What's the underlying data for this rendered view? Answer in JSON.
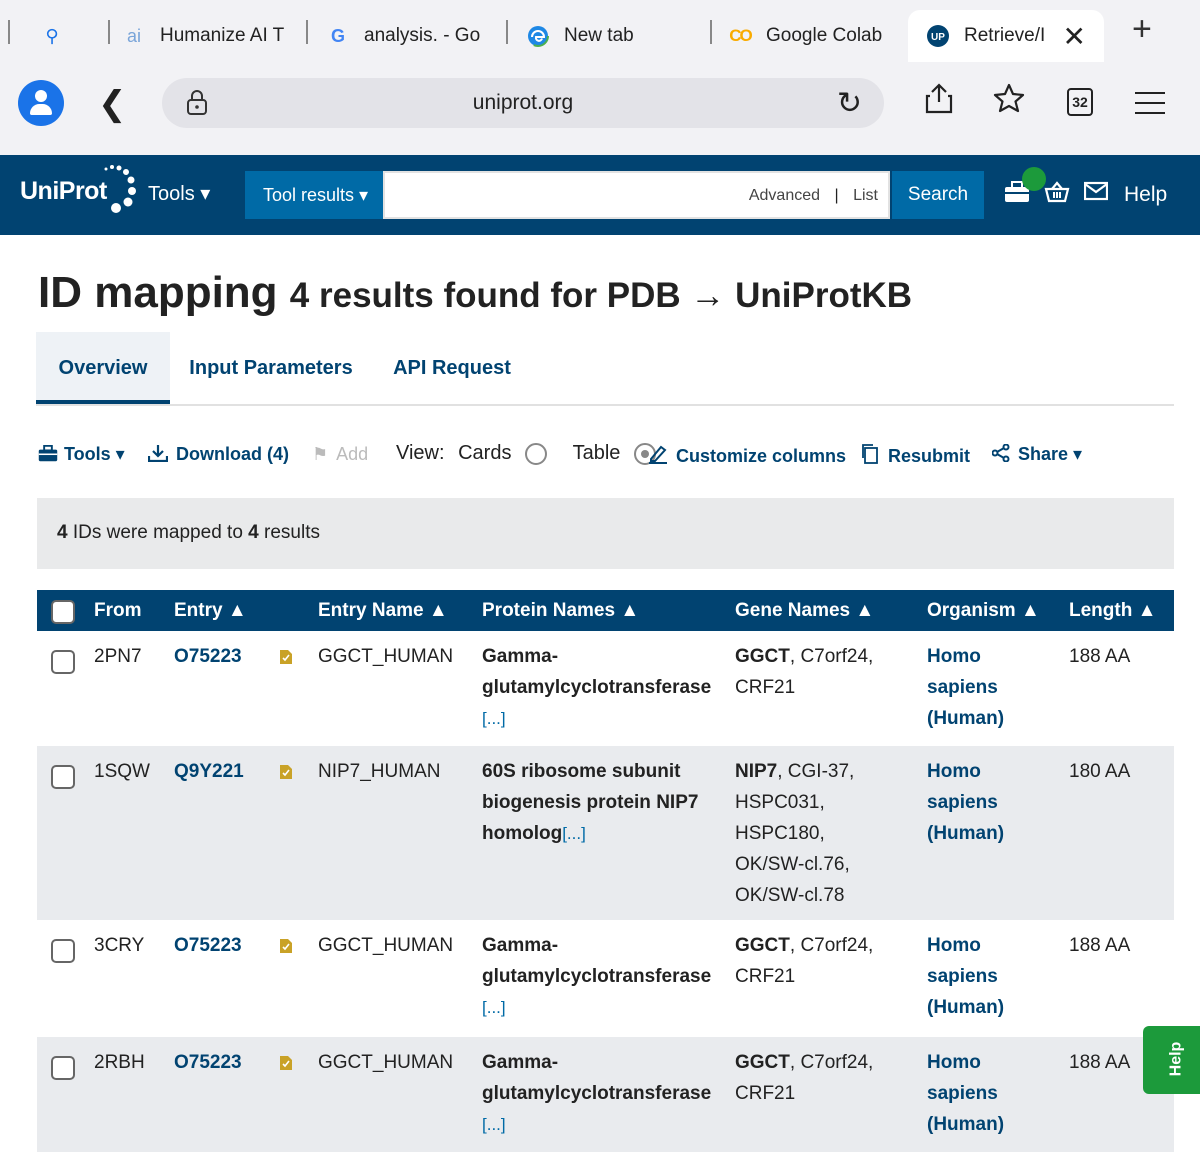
{
  "browser": {
    "tabs": [
      {
        "label": "",
        "icon": "search-icon"
      },
      {
        "label": "Humanize AI T",
        "icon": "ai-icon"
      },
      {
        "label": "analysis. - Go",
        "icon": "google-icon"
      },
      {
        "label": "New tab",
        "icon": "edge-icon"
      },
      {
        "label": "Google Colab",
        "icon": "colab-icon"
      },
      {
        "label": "Retrieve/I",
        "icon": "uniprot-icon",
        "active": true
      }
    ],
    "url": "uniprot.org",
    "tab_count": "32"
  },
  "header": {
    "logo": "UniProt",
    "tools": "Tools ▾",
    "tool_results": "Tool results ▾",
    "search_placeholder": "",
    "advanced": "Advanced",
    "list": "List",
    "search_button": "Search",
    "help": "Help"
  },
  "page": {
    "title": "ID mapping",
    "subtitle_prefix": "4 results found for PDB",
    "arrow": "→",
    "subtitle_target": "UniProtKB",
    "tabs": [
      "Overview",
      "Input Parameters",
      "API Request"
    ]
  },
  "toolbar": {
    "tools": "Tools ▾",
    "download": "Download (4)",
    "add": "Add",
    "view_label": "View:",
    "cards": "Cards",
    "table": "Table",
    "customize": "Customize columns",
    "resubmit": "Resubmit",
    "share": "Share ▾"
  },
  "info": {
    "count_in": "4",
    "text_mid": "IDs were mapped to",
    "count_out": "4",
    "text_end": "results"
  },
  "table": {
    "headers": [
      "From",
      "Entry ▲",
      "Entry Name ▲",
      "Protein Names ▲",
      "Gene Names ▲",
      "Organism ▲",
      "Length ▲"
    ],
    "rows": [
      {
        "from": "2PN7",
        "entry": "O75223",
        "entry_name": "GGCT_HUMAN",
        "protein_lines": [
          "Gamma-",
          "glutamylcyclotransferase"
        ],
        "protein_more": "[...]",
        "gene_primary": "GGCT",
        "gene_rest": ", C7orf24,",
        "gene_lines": [
          "CRF21"
        ],
        "organism_lines": [
          "Homo",
          "sapiens",
          "(Human)"
        ],
        "length": "188 AA"
      },
      {
        "from": "1SQW",
        "entry": "Q9Y221",
        "entry_name": "NIP7_HUMAN",
        "protein_lines": [
          "60S ribosome subunit",
          "biogenesis protein NIP7",
          "homolog"
        ],
        "protein_more": "[...]",
        "gene_primary": "NIP7",
        "gene_rest": ", CGI-37,",
        "gene_lines": [
          "HSPC031,",
          "HSPC180,",
          "OK/SW-cl.76,",
          "OK/SW-cl.78"
        ],
        "organism_lines": [
          "Homo",
          "sapiens",
          "(Human)"
        ],
        "length": "180 AA"
      },
      {
        "from": "3CRY",
        "entry": "O75223",
        "entry_name": "GGCT_HUMAN",
        "protein_lines": [
          "Gamma-",
          "glutamylcyclotransferase"
        ],
        "protein_more": "[...]",
        "gene_primary": "GGCT",
        "gene_rest": ", C7orf24,",
        "gene_lines": [
          "CRF21"
        ],
        "organism_lines": [
          "Homo",
          "sapiens",
          "(Human)"
        ],
        "length": "188 AA"
      },
      {
        "from": "2RBH",
        "entry": "O75223",
        "entry_name": "GGCT_HUMAN",
        "protein_lines": [
          "Gamma-",
          "glutamylcyclotransferase"
        ],
        "protein_more": "[...]",
        "gene_primary": "GGCT",
        "gene_rest": ", C7orf24,",
        "gene_lines": [
          "CRF21"
        ],
        "organism_lines": [
          "Homo",
          "sapiens",
          "(Human)"
        ],
        "length": "188 AA"
      }
    ]
  },
  "help_tab": "Help",
  "colors": {
    "brand_dark": "#014371",
    "brand_mid": "#006aa6",
    "help_green": "#1c9a3b",
    "reviewed_gold": "#c9a227"
  }
}
